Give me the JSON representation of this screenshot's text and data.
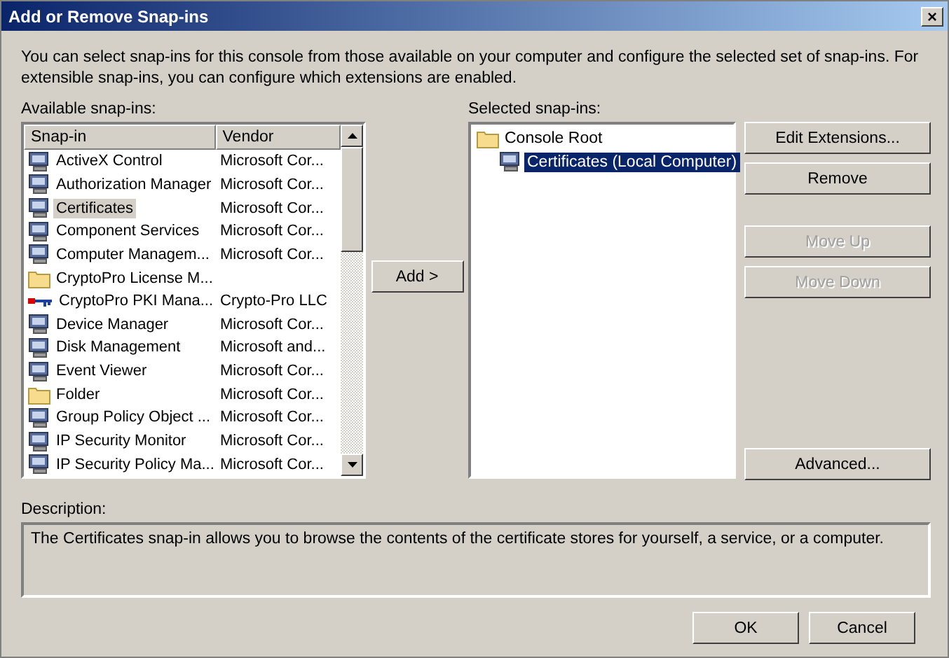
{
  "window": {
    "title": "Add or Remove Snap-ins",
    "close": "×"
  },
  "intro": "You can select snap-ins for this console from those available on your computer and configure the selected set of snap-ins. For extensible snap-ins, you can configure which extensions are enabled.",
  "available": {
    "label": "Available snap-ins:",
    "columns": [
      "Snap-in",
      "Vendor"
    ],
    "rows": [
      {
        "name": "ActiveX Control",
        "vendor": "Microsoft Cor...",
        "kind": "snapin",
        "selected": false
      },
      {
        "name": "Authorization Manager",
        "vendor": "Microsoft Cor...",
        "kind": "snapin",
        "selected": false
      },
      {
        "name": "Certificates",
        "vendor": "Microsoft Cor...",
        "kind": "snapin",
        "selected": true
      },
      {
        "name": "Component Services",
        "vendor": "Microsoft Cor...",
        "kind": "snapin",
        "selected": false
      },
      {
        "name": "Computer Managem...",
        "vendor": "Microsoft Cor...",
        "kind": "snapin",
        "selected": false
      },
      {
        "name": "CryptoPro License M...",
        "kind": "folder",
        "selected": false
      },
      {
        "name": "CryptoPro PKI Mana...",
        "vendor": "Crypto-Pro LLC",
        "kind": "key",
        "selected": false
      },
      {
        "name": "Device Manager",
        "vendor": "Microsoft Cor...",
        "kind": "snapin",
        "selected": false
      },
      {
        "name": "Disk Management",
        "vendor": "Microsoft and...",
        "kind": "snapin",
        "selected": false
      },
      {
        "name": "Event Viewer",
        "vendor": "Microsoft Cor...",
        "kind": "snapin",
        "selected": false
      },
      {
        "name": "Folder",
        "vendor": "Microsoft Cor...",
        "kind": "folder",
        "selected": false
      },
      {
        "name": "Group Policy Object ...",
        "vendor": "Microsoft Cor...",
        "kind": "snapin",
        "selected": false
      },
      {
        "name": "IP Security Monitor",
        "vendor": "Microsoft Cor...",
        "kind": "snapin",
        "selected": false
      },
      {
        "name": "IP Security Policy Ma...",
        "vendor": "Microsoft Cor...",
        "kind": "snapin",
        "selected": false
      }
    ]
  },
  "add_button": "Add >",
  "selected_snapins": {
    "label": "Selected snap-ins:",
    "tree": [
      {
        "name": "Console Root",
        "kind": "folder",
        "selected": false,
        "children": [
          {
            "name": "Certificates (Local Computer)",
            "kind": "snapin",
            "selected": true
          }
        ]
      }
    ]
  },
  "side_buttons": [
    {
      "label": "Edit Extensions...",
      "disabled": false
    },
    {
      "label": "Remove",
      "disabled": false
    },
    {
      "label": "Move Up",
      "disabled": true
    },
    {
      "label": "Move Down",
      "disabled": true
    },
    {
      "label": "Advanced...",
      "disabled": false
    }
  ],
  "description": {
    "label": "Description:",
    "text": "The Certificates snap-in allows you to browse the contents of the certificate stores for yourself, a service, or a computer."
  },
  "buttons": [
    "OK",
    "Cancel"
  ]
}
